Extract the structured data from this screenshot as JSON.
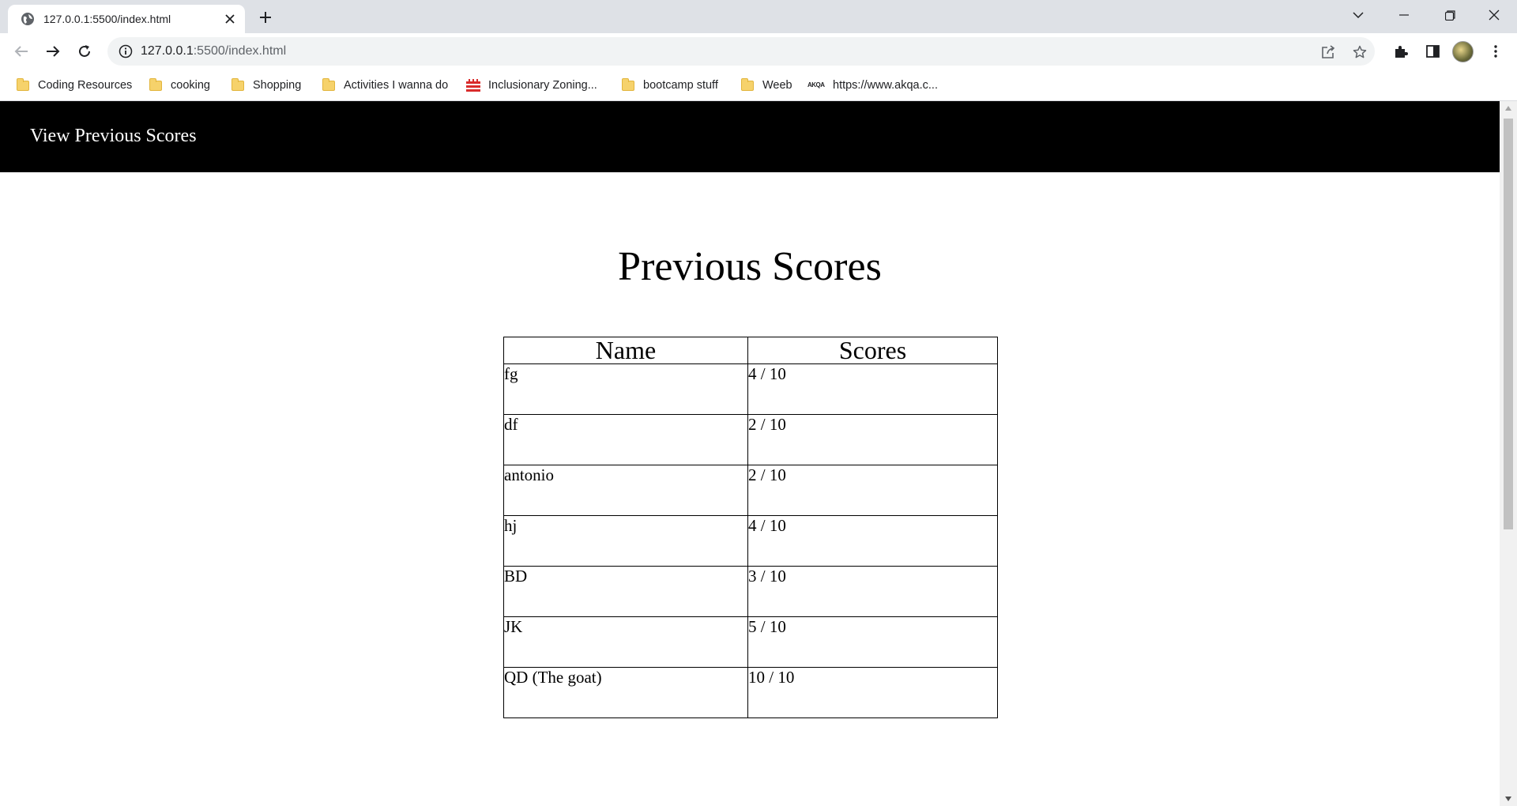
{
  "browser": {
    "tab_title": "127.0.0.1:5500/index.html",
    "url_host": "127.0.0.1",
    "url_rest": ":5500/index.html",
    "bookmarks": [
      {
        "label": "Coding Resources",
        "icon": "folder-icon"
      },
      {
        "label": "cooking",
        "icon": "folder-icon"
      },
      {
        "label": "Shopping",
        "icon": "folder-icon"
      },
      {
        "label": "Activities I wanna do",
        "icon": "folder-icon"
      },
      {
        "label": "Inclusionary Zoning...",
        "icon": "site-favicon-icon"
      },
      {
        "label": "bootcamp stuff",
        "icon": "folder-icon"
      },
      {
        "label": "Weeb",
        "icon": "folder-icon"
      },
      {
        "label": "https://www.akqa.c...",
        "icon": "akqa-favicon-icon",
        "favicon_text": "AKQA"
      }
    ]
  },
  "page": {
    "nav_link": "View Previous Scores",
    "title": "Previous Scores",
    "table": {
      "headers": [
        "Name",
        "Scores"
      ],
      "rows": [
        {
          "name": "fg",
          "score": "4 / 10"
        },
        {
          "name": "df",
          "score": "2 / 10"
        },
        {
          "name": "antonio",
          "score": "2 / 10"
        },
        {
          "name": "hj",
          "score": "4 / 10"
        },
        {
          "name": "BD",
          "score": "3 / 10"
        },
        {
          "name": "JK",
          "score": "5 / 10"
        },
        {
          "name": "QD (The goat)",
          "score": "10 / 10"
        }
      ]
    }
  }
}
